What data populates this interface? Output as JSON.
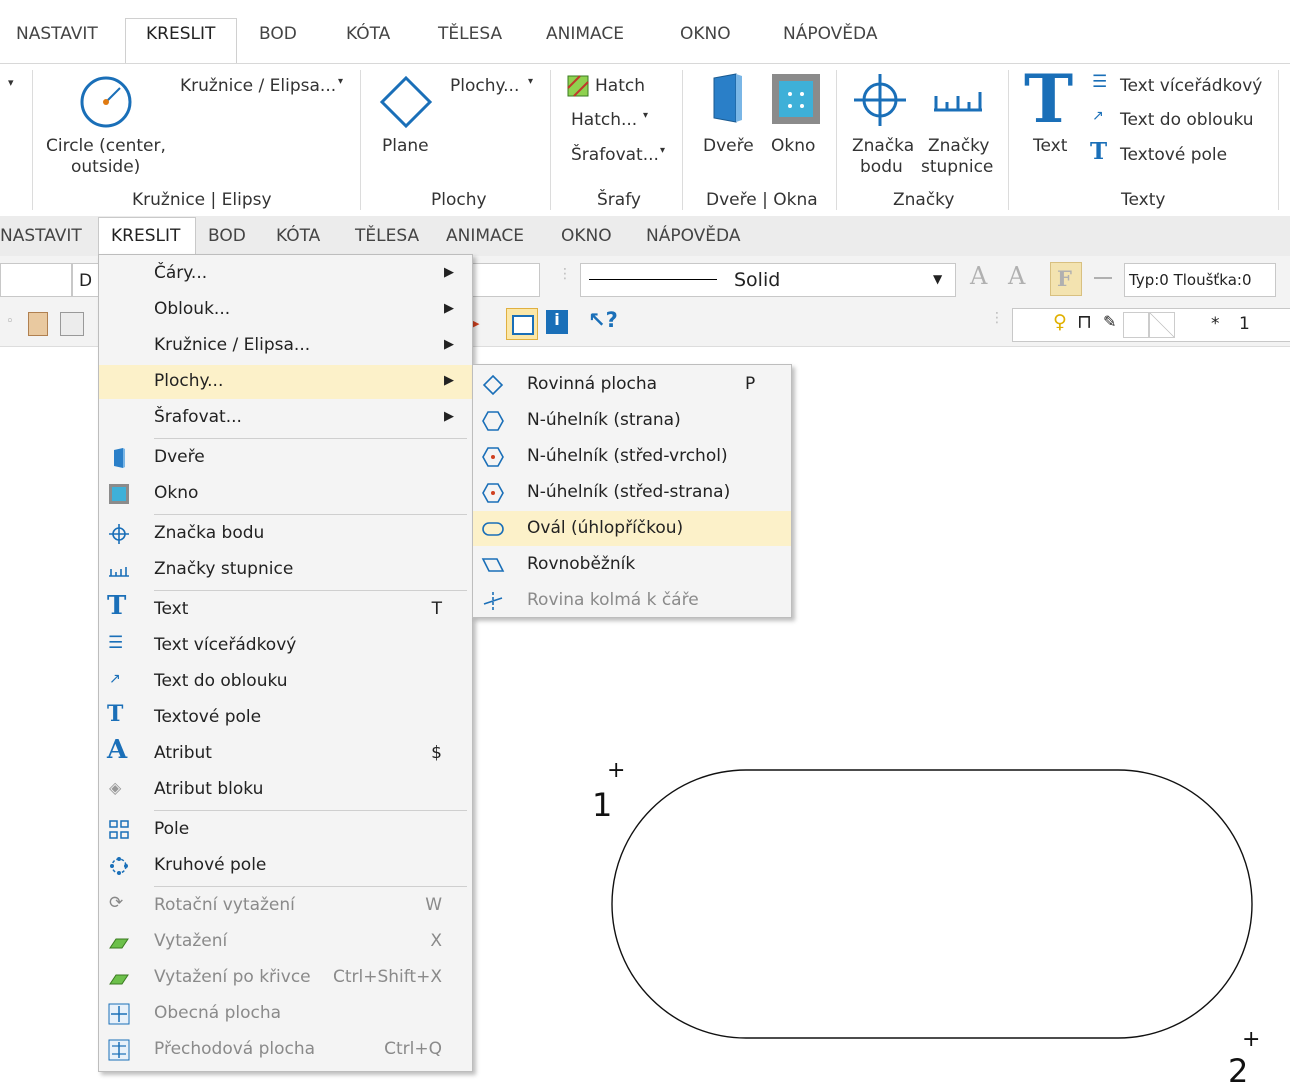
{
  "ribbon": {
    "tabs": [
      "NASTAVIT",
      "KRESLIT",
      "BOD",
      "KÓTA",
      "TĚLESA",
      "ANIMACE",
      "OKNO",
      "NÁPOVĚDA"
    ],
    "circle_label_1": "Circle (center,",
    "circle_label_2": "outside)",
    "circle_dropdown": "Kružnice / Elipsa...",
    "group_circles": "Kružnice | Elipsy",
    "plane_label": "Plane",
    "plane_dropdown": "Plochy...",
    "group_planes": "Plochy",
    "hatch_label": "Hatch",
    "hatch_dropdown": "Hatch...",
    "hatch_fill_dropdown": "Šrafovat...",
    "group_hatch": "Šrafy",
    "door_label": "Dveře",
    "window_label": "Okno",
    "group_doors": "Dveře | Okna",
    "point_mark_1": "Značka",
    "point_mark_2": "bodu",
    "scale_marks_1": "Značky",
    "scale_marks_2": "stupnice",
    "group_marks": "Značky",
    "text_label": "Text",
    "multiline_text": "Text víceřádkový",
    "arc_text": "Text do oblouku",
    "text_field": "Textové pole",
    "group_texts": "Texty"
  },
  "menubar": {
    "items": [
      "NASTAVIT",
      "KRESLIT",
      "BOD",
      "KÓTA",
      "TĚLESA",
      "ANIMACE",
      "OKNO",
      "NÁPOVĚDA"
    ]
  },
  "toolbar": {
    "combo_partial": "D",
    "line_style": "Solid",
    "type_thickness": "Typ:0  Tloušťka:0",
    "asterisk": "*",
    "layer_number": "1"
  },
  "main_menu": {
    "items": [
      {
        "label": "Čáry...",
        "shortcut": ""
      },
      {
        "label": "Oblouk...",
        "shortcut": ""
      },
      {
        "label": "Kružnice / Elipsa...",
        "shortcut": ""
      },
      {
        "label": "Plochy...",
        "shortcut": ""
      },
      {
        "label": "Šrafovat...",
        "shortcut": ""
      },
      {
        "label": "Dveře",
        "shortcut": ""
      },
      {
        "label": "Okno",
        "shortcut": ""
      },
      {
        "label": "Značka bodu",
        "shortcut": ""
      },
      {
        "label": "Značky stupnice",
        "shortcut": ""
      },
      {
        "label": "Text",
        "shortcut": "T"
      },
      {
        "label": "Text víceřádkový",
        "shortcut": ""
      },
      {
        "label": "Text do oblouku",
        "shortcut": ""
      },
      {
        "label": "Textové pole",
        "shortcut": ""
      },
      {
        "label": "Atribut",
        "shortcut": "$"
      },
      {
        "label": "Atribut bloku",
        "shortcut": ""
      },
      {
        "label": "Pole",
        "shortcut": ""
      },
      {
        "label": "Kruhové pole",
        "shortcut": ""
      },
      {
        "label": "Rotační vytažení",
        "shortcut": "W"
      },
      {
        "label": "Vytažení",
        "shortcut": "X"
      },
      {
        "label": "Vytažení po křivce",
        "shortcut": "Ctrl+Shift+X"
      },
      {
        "label": "Obecná plocha",
        "shortcut": ""
      },
      {
        "label": "Přechodová plocha",
        "shortcut": "Ctrl+Q"
      }
    ]
  },
  "sub_menu": {
    "items": [
      {
        "label": "Rovinná plocha",
        "shortcut": "P"
      },
      {
        "label": "N-úhelník (strana)",
        "shortcut": ""
      },
      {
        "label": "N-úhelník (střed-vrchol)",
        "shortcut": ""
      },
      {
        "label": "N-úhelník (střed-strana)",
        "shortcut": ""
      },
      {
        "label": "Ovál (úhlopříčkou)",
        "shortcut": ""
      },
      {
        "label": "Rovnoběžník",
        "shortcut": ""
      },
      {
        "label": "Rovina kolmá k čáře",
        "shortcut": ""
      }
    ]
  },
  "canvas": {
    "point1_label": "1",
    "point2_label": "2",
    "marker": "+"
  },
  "colors": {
    "highlight": "#fcf1c9",
    "icon_blue": "#1a6fb8",
    "menu_bg": "#f4f4f4",
    "disabled_text": "#8a8a8a"
  }
}
